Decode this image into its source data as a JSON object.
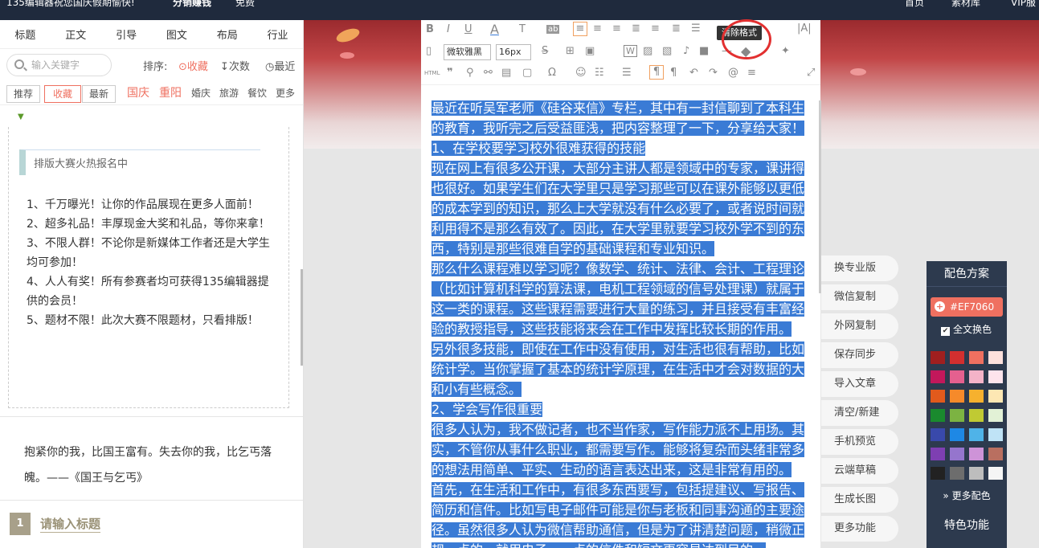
{
  "topbar": {
    "promo": "135编辑器祝您国庆假期愉快!",
    "earn": "分销赚钱",
    "free": "免费",
    "home": "首页",
    "library": "素材库",
    "vip": "VIP服"
  },
  "left": {
    "tabs": [
      "标题",
      "正文",
      "引导",
      "图文",
      "布局",
      "行业"
    ],
    "search_placeholder": "输入关键字",
    "sort_label": "排序:",
    "sort": [
      "收藏",
      "次数",
      "最近"
    ],
    "cats": [
      "推荐",
      "收藏",
      "最新",
      "国庆",
      "重阳",
      "婚庆",
      "旅游",
      "餐饮",
      "更多"
    ],
    "card_title": "排版大赛火热报名中",
    "card_lines": [
      "1、千万曝光！让你的作品展现在更多人面前！",
      "2、超多礼品！丰厚现金大奖和礼品，等你来拿！",
      "3、不限人群！不论你是新媒体工作者还是大学生均可参加！",
      "4、人人有奖！所有参赛者均可获得135编辑器提供的会员！",
      "5、题材不限！此次大赛不限题材，只看排版！"
    ],
    "quote": "抱紧你的我，比国王富有。失去你的我，比乞丐落魄。——《国王与乞丐》",
    "header_num": "1",
    "header_title": "请输入标题"
  },
  "toolbar": {
    "font": "微软雅黑",
    "size": "16px",
    "tooltip": "清除格式",
    "html": "HTML"
  },
  "content": [
    "最近在听吴军老师《硅谷来信》专栏，其中有一封信聊到了本科生的教育，我听完之后受益匪浅，把内容整理了一下，分享给大家！",
    "1、在学校要学习校外很难获得的技能",
    "现在网上有很多公开课，大部分主讲人都是领域中的专家，课讲得也很好。如果学生们在大学里只是学习那些可以在课外能够以更低的成本学到的知识，那么上大学就没有什么必要了，或者说时间就利用得不是那么有效了。因此，在大学里就要学习校外学不到的东西，特别是那些很难自学的基础课程和专业知识。",
    "那么什么课程难以学习呢？像数学、统计、法律、会计、工程理论（比如计算机科学的算法课，电机工程领域的信号处理课）就属于这一类的课程。这些课程需要进行大量的练习，并且接受有丰富经验的教授指导，这些技能将来会在工作中发挥比较长期的作用。",
    "另外很多技能，即使在工作中没有使用，对生活也很有帮助，比如统计学。当你掌握了基本的统计学原理，在生活中才会对数据的大和小有些概念。",
    "2、学会写作很重要",
    "很多人认为，我不做记者，也不当作家，写作能力派不上用场。其实，不管你从事什么职业，都需要写作。能够将复杂而头绪非常多的想法用简单、平实、生动的语言表达出来，这是非常有用的。",
    "首先，在生活和工作中，有很多东西要写，包括提建议、写报告、简历和信件。比如写电子邮件可能是你与老板和同事沟通的主要途径。虽然很多人认为微信帮助通信，但是为了讲清楚问题，稍微正规一点的，就用电子，一点的信件和短文更容易达到目的。"
  ],
  "side_buttons": [
    "换专业版",
    "微信复制",
    "外网复制",
    "保存同步",
    "导入文章",
    "清空/新建",
    "手机预览",
    "云端草稿",
    "生成长图",
    "更多功能"
  ],
  "color_panel": {
    "title": "配色方案",
    "current": "#EF7060",
    "all_label": "全文换色",
    "more": "更多配色",
    "feature": "特色功能",
    "swatches": [
      "#a01f1f",
      "#d32f2f",
      "#ef7060",
      "#fde0dc",
      "#c2185b",
      "#e5608f",
      "#f4b3c8",
      "#fde4ec",
      "#e25a1c",
      "#f68a2a",
      "#f6b12e",
      "#fde7b3",
      "#1a8a2e",
      "#7cb342",
      "#c0ca33",
      "#e2f1d6",
      "#3949ab",
      "#1e88e5",
      "#4fb3e8",
      "#bfe3f6",
      "#7e3fb2",
      "#9575cd",
      "#ce93d8",
      "#b96f60",
      "#222222",
      "#6d6d6d",
      "#bdbdbd",
      "#f5f5f5"
    ]
  }
}
